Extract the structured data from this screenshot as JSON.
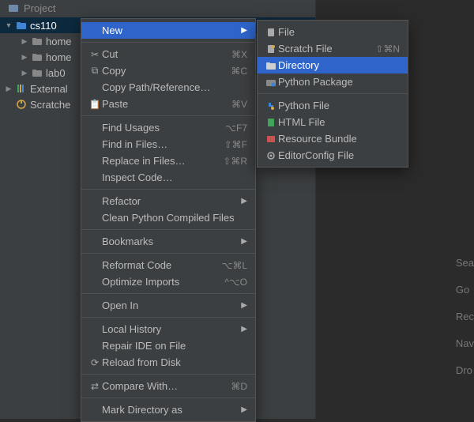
{
  "toolbar": {
    "project_label": "Project"
  },
  "tree": {
    "root": "cs110",
    "children": [
      {
        "label": "home"
      },
      {
        "label": "home"
      },
      {
        "label": "lab0"
      }
    ],
    "external": "External",
    "scratches": "Scratche"
  },
  "menu": {
    "new": "New",
    "cut": {
      "label": "Cut",
      "shortcut": "⌘X"
    },
    "copy": {
      "label": "Copy",
      "shortcut": "⌘C"
    },
    "copy_path": "Copy Path/Reference…",
    "paste": {
      "label": "Paste",
      "shortcut": "⌘V"
    },
    "find_usages": {
      "label": "Find Usages",
      "shortcut": "⌥F7"
    },
    "find_in_files": {
      "label": "Find in Files…",
      "shortcut": "⇧⌘F"
    },
    "replace_in_files": {
      "label": "Replace in Files…",
      "shortcut": "⇧⌘R"
    },
    "inspect_code": "Inspect Code…",
    "refactor": "Refactor",
    "clean_compiled": "Clean Python Compiled Files",
    "bookmarks": "Bookmarks",
    "reformat": {
      "label": "Reformat Code",
      "shortcut": "⌥⌘L"
    },
    "optimize": {
      "label": "Optimize Imports",
      "shortcut": "^⌥O"
    },
    "open_in": "Open In",
    "local_history": "Local History",
    "repair_ide": "Repair IDE on File",
    "reload_disk": "Reload from Disk",
    "compare_with": {
      "label": "Compare With…",
      "shortcut": "⌘D"
    },
    "mark_dir": "Mark Directory as"
  },
  "submenu": {
    "file": "File",
    "scratch_file": {
      "label": "Scratch File",
      "shortcut": "⇧⌘N"
    },
    "directory": "Directory",
    "python_package": "Python Package",
    "python_file": "Python File",
    "html_file": "HTML File",
    "resource_bundle": "Resource Bundle",
    "editorconfig": "EditorConfig File"
  },
  "hints": {
    "search": "Sea",
    "goto": "Go",
    "recent": "Rec",
    "nav": "Nav",
    "drop": "Dro"
  }
}
